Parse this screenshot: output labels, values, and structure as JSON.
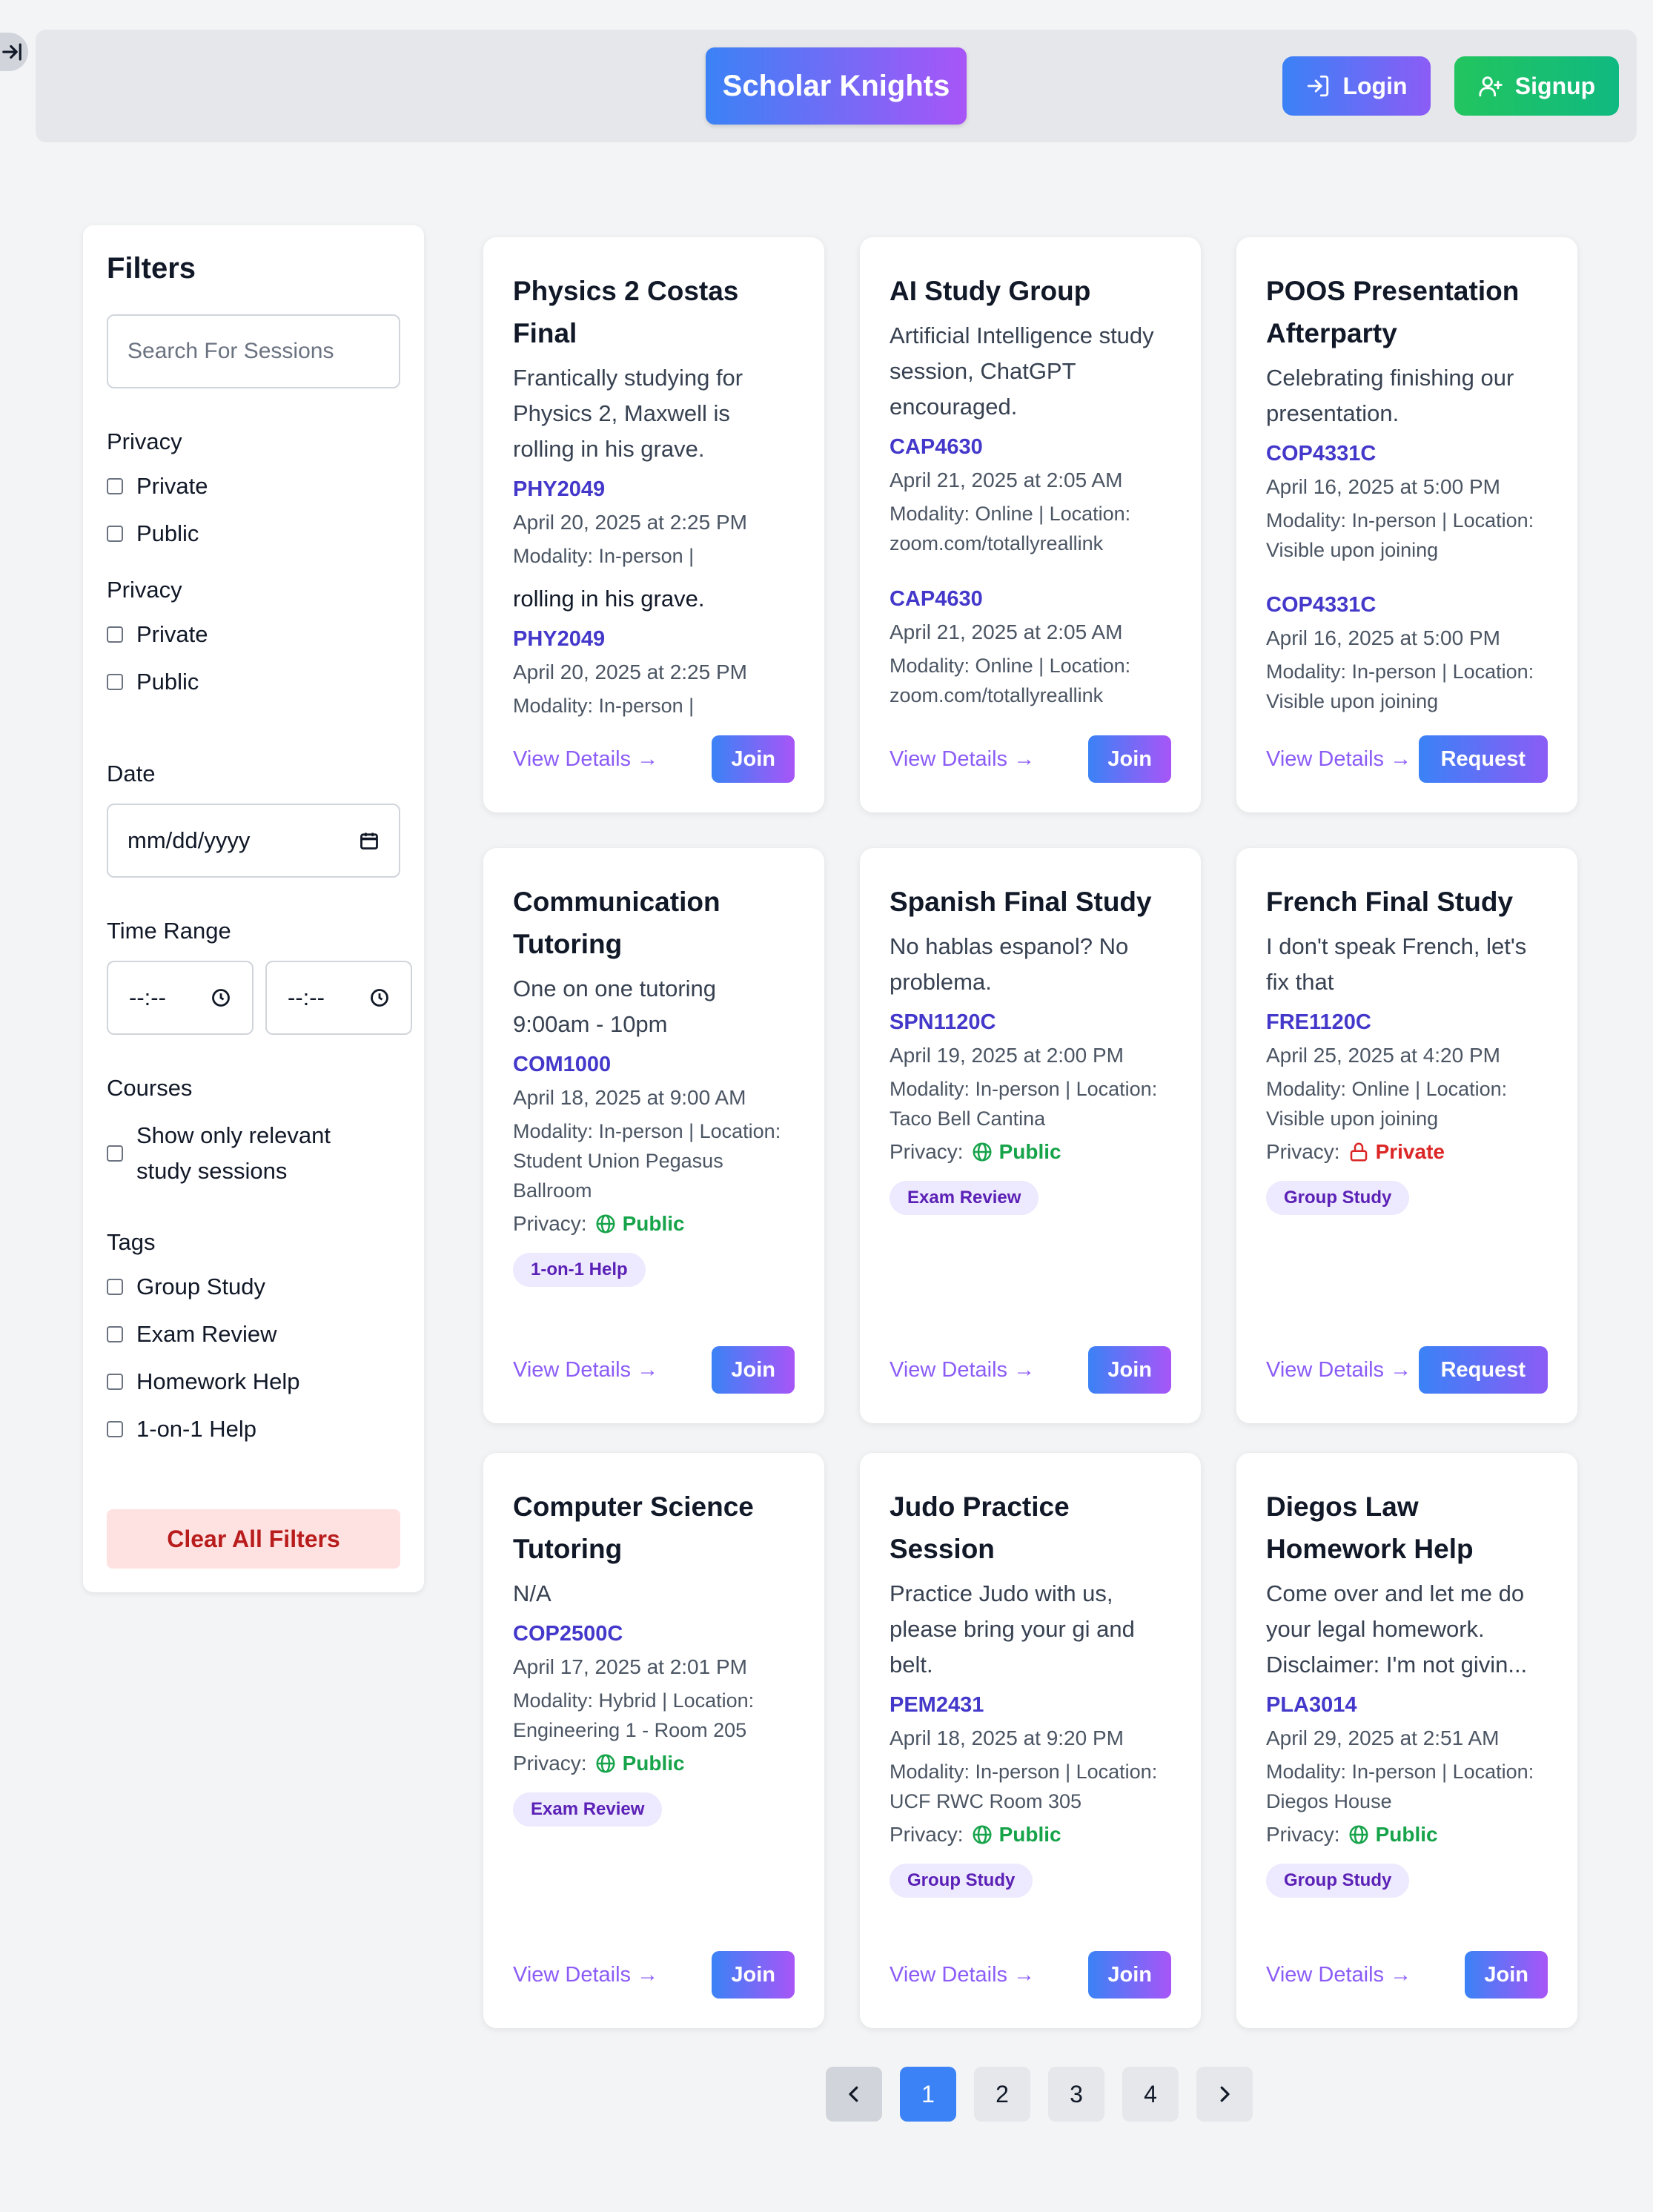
{
  "header": {
    "brand": "Scholar Knights",
    "login": "Login",
    "signup": "Signup"
  },
  "filters": {
    "title": "Filters",
    "search_placeholder": "Search For Sessions",
    "privacy_heading": "Privacy",
    "privacy_options": [
      "Private",
      "Public"
    ],
    "date_heading": "Date",
    "date_placeholder": "mm/dd/yyyy",
    "time_heading": "Time Range",
    "time_placeholder": "--:--",
    "courses_heading": "Courses",
    "courses_option": "Show only relevant study sessions",
    "tags_heading": "Tags",
    "tag_options": [
      "Group Study",
      "Exam Review",
      "Homework Help",
      "1-on-1 Help"
    ],
    "clear": "Clear All Filters"
  },
  "labels": {
    "privacy": "Privacy:",
    "view_details": "View Details →",
    "join": "Join",
    "request": "Request",
    "public": "Public",
    "private": "Private"
  },
  "cards": [
    {
      "title": "Physics 2 Costas Final",
      "desc": "Frantically studying for Physics 2, Maxwell is rolling in his grave.",
      "code": "PHY2049",
      "date": "April 20, 2025 at 2:25 PM",
      "meta": "Modality: In-person |",
      "action": "Join",
      "overflow": {
        "desc": "rolling in his grave.",
        "code": "PHY2049",
        "date": "April 20, 2025 at 2:25 PM",
        "meta": "Modality: In-person |"
      }
    },
    {
      "title": "AI Study Group",
      "desc": "Artificial Intelligence study session, ChatGPT encouraged.",
      "code": "CAP4630",
      "date": "April 21, 2025 at 2:05 AM",
      "meta": "Modality: Online | Location: zoom.com/totallyreallink",
      "action": "Join",
      "overflow": {
        "code": "CAP4630",
        "date": "April 21, 2025 at 2:05 AM",
        "meta": "Modality: Online | Location: zoom.com/totallyreallink"
      }
    },
    {
      "title": "POOS Presentation Afterparty",
      "desc": "Celebrating finishing our presentation.",
      "code": "COP4331C",
      "date": "April 16, 2025 at 5:00 PM",
      "meta": "Modality: In-person | Location: Visible upon joining",
      "action": "Request",
      "overflow": {
        "code": "COP4331C",
        "date": "April 16, 2025 at 5:00 PM",
        "meta": "Modality: In-person | Location: Visible upon joining"
      }
    },
    {
      "title": "Communication Tutoring",
      "desc": "One on one tutoring 9:00am - 10pm",
      "code": "COM1000",
      "date": "April 18, 2025 at 9:00 AM",
      "meta": "Modality: In-person | Location: Student Union Pegasus Ballroom",
      "privacy": "Public",
      "tag": "1-on-1 Help",
      "action": "Join"
    },
    {
      "title": "Spanish Final Study",
      "desc": "No hablas espanol? No problema.",
      "code": "SPN1120C",
      "date": "April 19, 2025 at 2:00 PM",
      "meta": "Modality: In-person | Location: Taco Bell Cantina",
      "privacy": "Public",
      "tag": "Exam Review",
      "action": "Join"
    },
    {
      "title": "French Final Study",
      "desc": "I don't speak French, let's fix that",
      "code": "FRE1120C",
      "date": "April 25, 2025 at 4:20 PM",
      "meta": "Modality: Online | Location: Visible upon joining",
      "privacy": "Private",
      "tag": "Group Study",
      "action": "Request"
    },
    {
      "title": "Computer Science Tutoring",
      "desc": "N/A",
      "code": "COP2500C",
      "date": "April 17, 2025 at 2:01 PM",
      "meta": "Modality: Hybrid | Location: Engineering 1 - Room 205",
      "privacy": "Public",
      "tag": "Exam Review",
      "action": "Join"
    },
    {
      "title": "Judo Practice Session",
      "desc": "Practice Judo with us, please bring your gi and belt.",
      "code": "PEM2431",
      "date": "April 18, 2025 at 9:20 PM",
      "meta": "Modality: In-person | Location: UCF RWC Room 305",
      "privacy": "Public",
      "tag": "Group Study",
      "action": "Join"
    },
    {
      "title": "Diegos Law Homework Help",
      "desc": "Come over and let me do your legal homework. Disclaimer: I'm not givin...",
      "code": "PLA3014",
      "date": "April 29, 2025 at 2:51 AM",
      "meta": "Modality: In-person | Location: Diegos House",
      "privacy": "Public",
      "tag": "Group Study",
      "action": "Join"
    }
  ],
  "pagination": {
    "pages": [
      "1",
      "2",
      "3",
      "4"
    ],
    "current": "1"
  },
  "colors": {
    "brand_gradient_start": "#3b82f6",
    "brand_gradient_end": "#a855f7",
    "signup": "#22c55e",
    "public": "#16a34a",
    "private": "#dc2626",
    "course_code": "#4338ca",
    "tag_bg": "#ede9fe"
  }
}
